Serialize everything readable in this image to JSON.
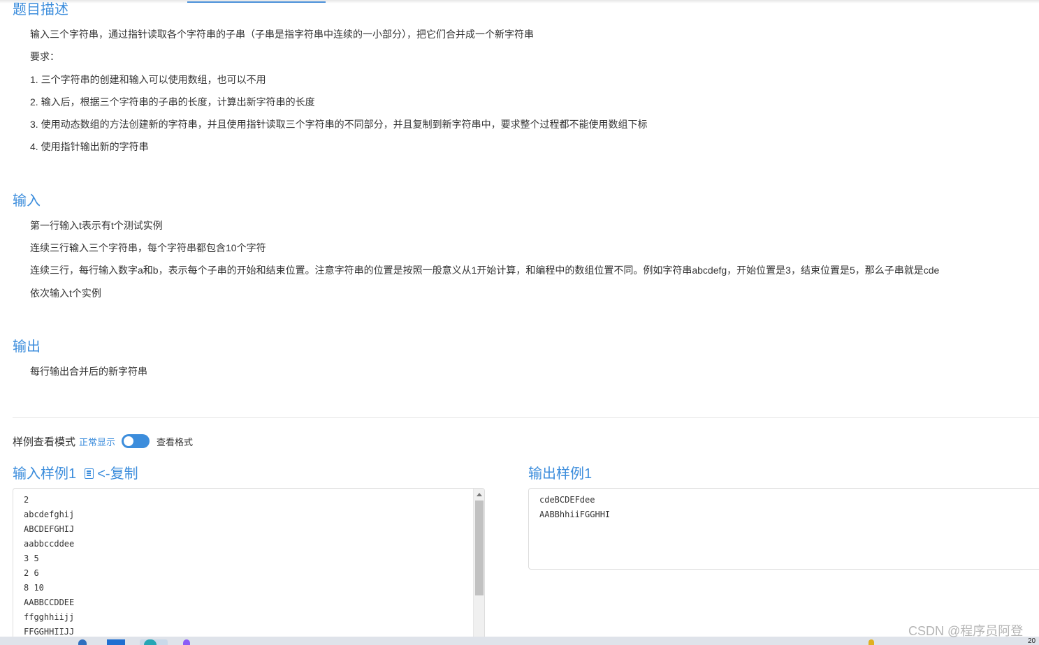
{
  "problem": {
    "title": "题目描述",
    "lines": [
      "输入三个字符串，通过指针读取各个字符串的子串（子串是指字符串中连续的一小部分），把它们合并成一个新字符串",
      "要求：",
      "1. 三个字符串的创建和输入可以使用数组，也可以不用",
      "2. 输入后，根据三个字符串的子串的长度，计算出新字符串的长度",
      "3. 使用动态数组的方法创建新的字符串，并且使用指针读取三个字符串的不同部分，并且复制到新字符串中，要求整个过程都不能使用数组下标",
      "4. 使用指针输出新的字符串"
    ]
  },
  "input_section": {
    "title": "输入",
    "lines": [
      "第一行输入t表示有t个测试实例",
      "连续三行输入三个字符串，每个字符串都包含10个字符",
      "连续三行，每行输入数字a和b，表示每个子串的开始和结束位置。注意字符串的位置是按照一般意义从1开始计算，和编程中的数组位置不同。例如字符串abcdefg，开始位置是3，结束位置是5，那么子串就是cde",
      "依次输入t个实例"
    ]
  },
  "output_section": {
    "title": "输出",
    "lines": [
      "每行输出合并后的新字符串"
    ]
  },
  "sample_mode": {
    "label": "样例查看模式",
    "normal": "正常显示",
    "format": "查看格式"
  },
  "sample_input": {
    "title": "输入样例1",
    "copy_label": "<-复制",
    "text": "2\nabcdefghij\nABCDEFGHIJ\naabbccddee\n3 5\n2 6\n8 10\nAABBCCDDEE\nffgghhiijj\nFFGGHHIIJJ"
  },
  "sample_output": {
    "title": "输出样例1",
    "text": "cdeBCDEFdee\nAABBhhiiFGGHHI"
  },
  "watermark": "CSDN @程序员阿登",
  "taskbar": {
    "clock_fragment": "20"
  },
  "colors": {
    "accent": "#3c8ddc",
    "text": "#333333",
    "border": "#dddddd"
  }
}
